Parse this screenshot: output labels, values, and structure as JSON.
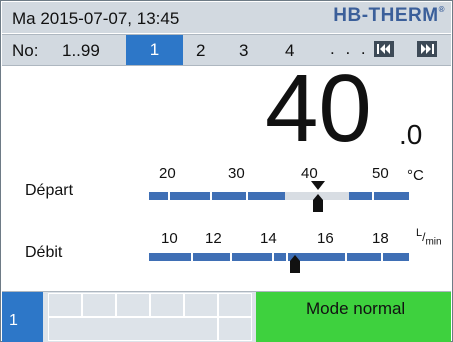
{
  "header": {
    "datetime": "Ma 2015-07-07, 13:45",
    "logo": "HB-THERM",
    "logo_mark": "®"
  },
  "nav": {
    "label": "No:",
    "range": "1..99",
    "selected": "1",
    "items": [
      "2",
      "3",
      "4"
    ],
    "dots": ". . . .",
    "prev_icon": "skip-back-icon",
    "next_icon": "skip-forward-icon"
  },
  "main": {
    "value": "40",
    "decimal": ".0"
  },
  "depart": {
    "label": "Départ",
    "ticks": [
      "20",
      "30",
      "40",
      "50"
    ],
    "unit": "°C",
    "setpoint": 40,
    "actual": 40
  },
  "debit": {
    "label": "Débit",
    "ticks": [
      "10",
      "12",
      "14",
      "16",
      "18"
    ],
    "unit": "L/min",
    "unit_num": "L",
    "unit_den": "min",
    "actual": 14.7
  },
  "footer": {
    "num": "1",
    "mode": "Mode normal"
  },
  "colors": {
    "header_bg": "#d2d9e0",
    "selected_bg": "#2d77c8",
    "bar_blue": "#3f6fb5",
    "mode_green": "#3ed13e",
    "logo_blue": "#3b5f9a"
  }
}
